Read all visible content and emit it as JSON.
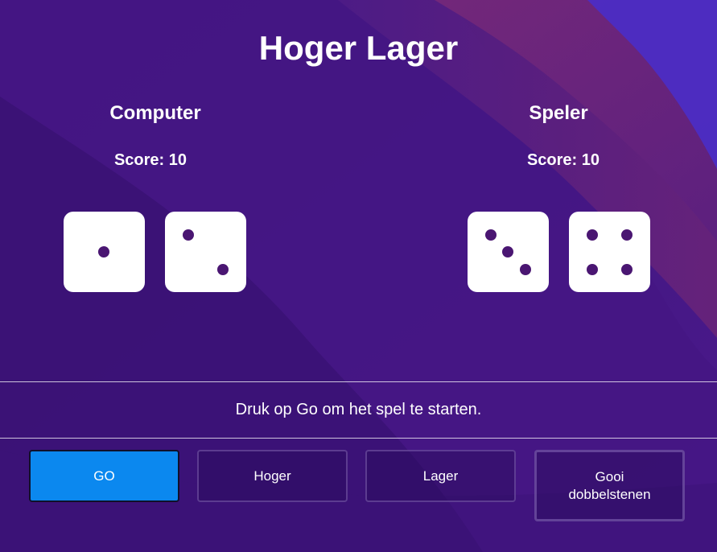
{
  "game": {
    "title": "Hoger Lager",
    "status_message": "Druk op Go om het spel te starten."
  },
  "computer": {
    "name": "Computer",
    "score_label": "Score:",
    "score": "10",
    "dice": [
      1,
      2
    ]
  },
  "player": {
    "name": "Speler",
    "score_label": "Score:",
    "score": "10",
    "dice": [
      3,
      4
    ]
  },
  "buttons": {
    "go": "GO",
    "higher": "Hoger",
    "lower": "Lager",
    "roll": "Gooi dobbelstenen"
  },
  "colors": {
    "background": "#3a1275",
    "pip": "#4a1672",
    "go_button": "#0b88ef"
  }
}
